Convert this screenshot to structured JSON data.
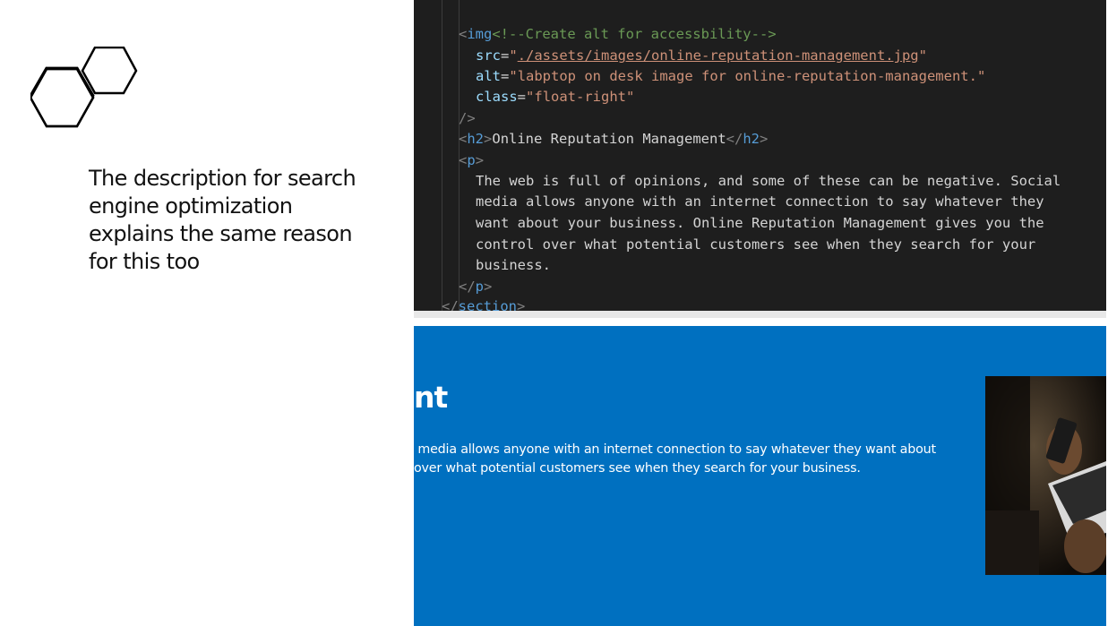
{
  "slide": {
    "text_lines": [
      "The description for search",
      "engine optimization",
      "explains the same reason",
      "for this too"
    ]
  },
  "code": {
    "comment": "<!--Create alt for accessbility-->",
    "img_tag": "img",
    "src_attr": "src",
    "src_value": "./assets/images/online-reputation-management.jpg",
    "alt_attr": "alt",
    "alt_value": "labptop on desk image for online-reputation-management.",
    "class_attr": "class",
    "class_value": "float-right",
    "self_close": "/>",
    "h2_tag": "h2",
    "h2_text": "Online Reputation Management",
    "p_tag": "p",
    "p_lines": [
      "The web is full of opinions, and some of these can be negative. Social",
      "media allows anyone with an internet connection to say whatever they",
      "want about your business. Online Reputation Management gives you the",
      "control over what potential customers see when they search for your",
      "business."
    ],
    "section_tag": "section"
  },
  "preview": {
    "heading": "nt",
    "lines": [
      " media allows anyone with an internet connection to say whatever they want about",
      "over what potential customers see when they search for your business."
    ]
  },
  "colors": {
    "editor_bg": "#1e1e1e",
    "preview_bg": "#0070c0"
  }
}
